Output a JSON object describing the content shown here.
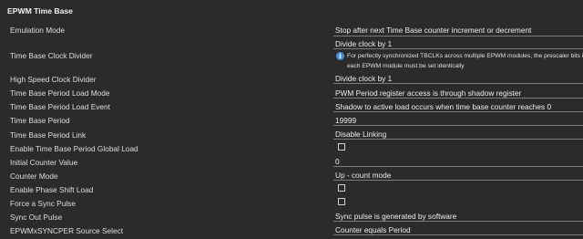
{
  "section": {
    "title": "EPWM Time Base"
  },
  "rows": [
    {
      "label": "Emulation Mode",
      "value": "Stop after next Time Base counter increment or decrement"
    },
    {
      "label": "Time Base Clock Divider",
      "value": "Divide clock by 1",
      "info": {
        "line1": "For perfectly synchronized TBCLKs across multiple EPWM modules, the prescaler bits in",
        "line2": "each EPWM module must be set identically"
      }
    },
    {
      "label": "High Speed Clock Divider",
      "value": "Divide clock by 1"
    },
    {
      "label": "Time Base Period Load Mode",
      "value": "PWM Period register access is through shadow register"
    },
    {
      "label": "Time Base Period Load Event",
      "value": "Shadow to active load occurs when time base counter reaches 0"
    },
    {
      "label": "Time Base Period",
      "value": "19999"
    },
    {
      "label": "Time Base Period Link",
      "value": "Disable Linking"
    },
    {
      "label": "Enable Time Base Period Global Load",
      "checked": false
    },
    {
      "label": "Initial Counter Value",
      "value": "0"
    },
    {
      "label": "Counter Mode",
      "value": "Up - count mode"
    },
    {
      "label": "Enable Phase Shift Load",
      "checked": false
    },
    {
      "label": "Force a Sync Pulse",
      "checked": false
    },
    {
      "label": "Sync Out Pulse",
      "value": "Sync pulse is generated by software"
    },
    {
      "label": "EPWMxSYNCPER Source Select",
      "value": "Counter equals Period"
    }
  ],
  "icons": {
    "info": "info-icon"
  },
  "colors": {
    "background": "#2b2b2b",
    "info_icon": "#4a90d9"
  }
}
